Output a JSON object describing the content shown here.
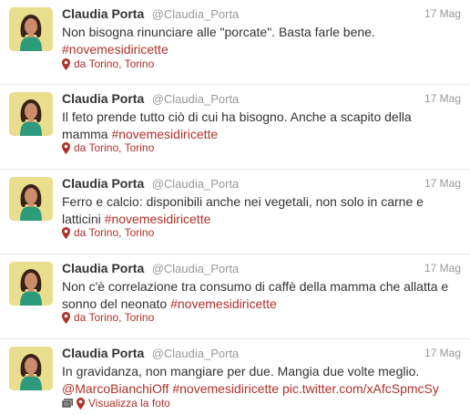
{
  "tweets": [
    {
      "name": "Claudia Porta",
      "handle": "@Claudia_Porta",
      "time": "17 Mag",
      "text": "Non bisogna rinunciare alle \"porcate\". Basta farle bene.",
      "hashtag": "#novemesidiricette",
      "location": "da Torino, Torino"
    },
    {
      "name": "Claudia Porta",
      "handle": "@Claudia_Porta",
      "time": "17 Mag",
      "text": "Il feto prende tutto ciò di cui ha bisogno. Anche a scapito della mamma",
      "hashtag": "#novemesidiricette",
      "location": "da Torino, Torino"
    },
    {
      "name": "Claudia Porta",
      "handle": "@Claudia_Porta",
      "time": "17 Mag",
      "text": "Ferro e calcio: disponibili anche nei vegetali, non solo in carne e latticini",
      "hashtag": "#novemesidiricette",
      "location": "da Torino, Torino"
    },
    {
      "name": "Claudia Porta",
      "handle": "@Claudia_Porta",
      "time": "17 Mag",
      "text": "Non c'è correlazione tra consumo di caffè della mamma che allatta e sonno del neonato",
      "hashtag": "#novemesidiricette",
      "location": "da Torino, Torino"
    },
    {
      "name": "Claudia Porta",
      "handle": "@Claudia_Porta",
      "time": "17 Mag",
      "text": "In gravidanza, non mangiare per due. Mangia due volte meglio.",
      "mention": "@MarcoBianchiOff",
      "hashtag": "#novemesidiricette",
      "link": "pic.twitter.com/xAfcSpmcSy",
      "view_photo": "Visualizza la foto"
    }
  ],
  "colors": {
    "accent": "#b0302a",
    "muted": "#999999",
    "text": "#333333",
    "avatar_bg": "#e9dd8e"
  },
  "icons": {
    "location": "map-pin-icon",
    "photo": "photo-icon"
  }
}
